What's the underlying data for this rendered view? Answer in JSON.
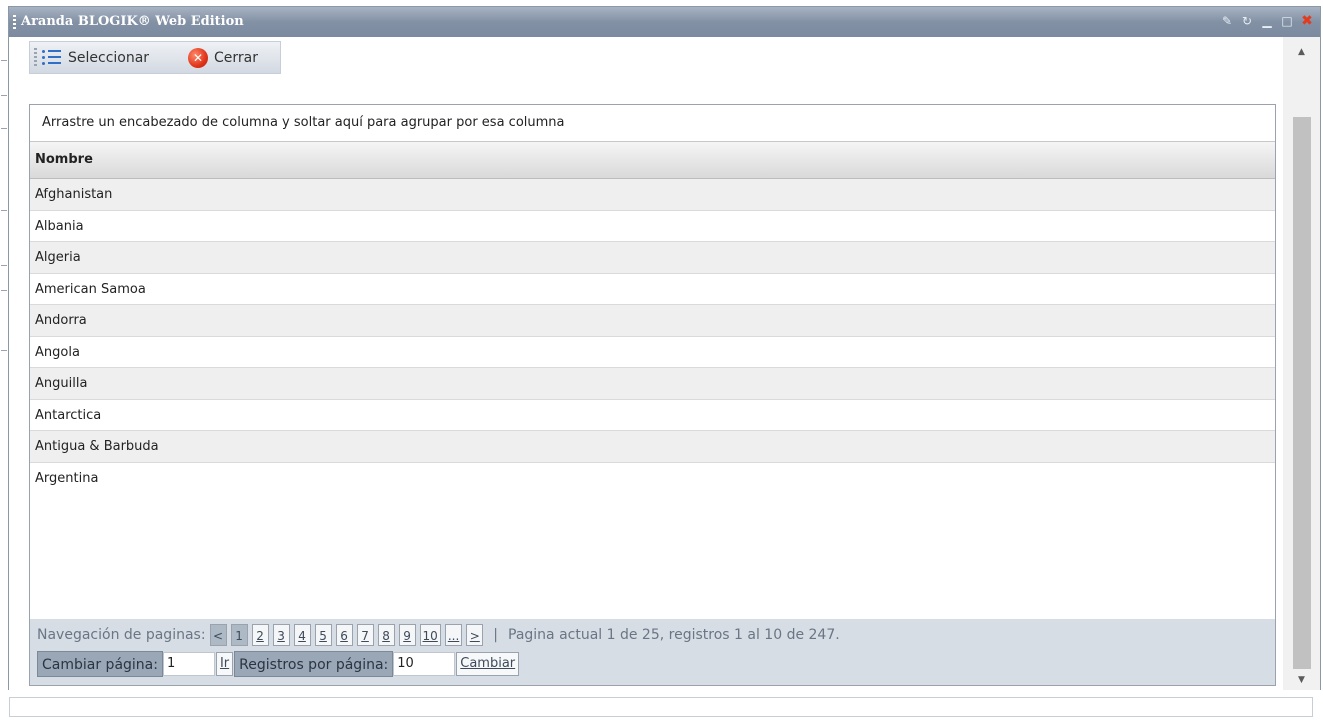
{
  "window": {
    "title": "Aranda BLOGIK® Web Edition",
    "icons": [
      "pin-icon",
      "refresh-icon",
      "minimize-icon",
      "maximize-icon",
      "close-icon"
    ]
  },
  "toolbar": {
    "select_label": "Seleccionar",
    "close_label": "Cerrar"
  },
  "grid": {
    "group_hint": "Arrastre un encabezado de columna y soltar aquí para agrupar por esa columna",
    "column_header": "Nombre",
    "rows": [
      "Afghanistan",
      "Albania",
      "Algeria",
      "American Samoa",
      "Andorra",
      "Angola",
      "Anguilla",
      "Antarctica",
      "Antigua & Barbuda",
      "Argentina"
    ]
  },
  "pager": {
    "nav_label": "Navegación de paginas:",
    "prev": "<",
    "pages": [
      "1",
      "2",
      "3",
      "4",
      "5",
      "6",
      "7",
      "8",
      "9",
      "10",
      "..."
    ],
    "next": ">",
    "separator": "|",
    "summary": "Pagina actual 1 de 25, registros 1 al 10 de 247.",
    "change_page_label": "Cambiar página:",
    "page_value": "1",
    "go_label": "Ir",
    "per_page_label": "Registros por página:",
    "per_page_value": "10",
    "change_label": "Cambiar"
  }
}
